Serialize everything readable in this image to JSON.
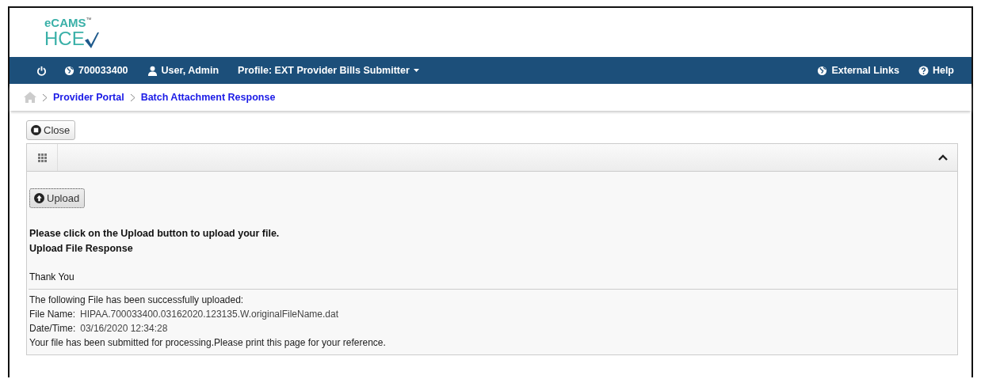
{
  "logo": {
    "brand": "eCAMS",
    "trademark": "™",
    "product": "HCE"
  },
  "navbar": {
    "left": [
      {
        "kind": "power"
      },
      {
        "kind": "globe",
        "label": "700033400"
      },
      {
        "kind": "user",
        "label": "User, Admin"
      },
      {
        "kind": "dropdown",
        "label": "Profile: EXT Provider Bills Submitter"
      }
    ],
    "right": [
      {
        "kind": "globe",
        "label": "External Links"
      },
      {
        "kind": "help",
        "label": "Help"
      }
    ]
  },
  "breadcrumb": [
    "Provider Portal",
    "Batch Attachment Response"
  ],
  "close_button": "Close",
  "panel": {
    "expanded": true,
    "upload_button": "Upload",
    "instruction": "Please click on the Upload button to upload your file.",
    "heading": "Upload File Response",
    "thanks": "Thank You",
    "details": [
      {
        "kind": "text",
        "text": "The following File has been successfully uploaded:"
      },
      {
        "kind": "field",
        "label": "File Name:",
        "value": "HIPAA.700033400.03162020.123135.W.originalFileName.dat"
      },
      {
        "kind": "field",
        "label": "Date/Time:",
        "value": "03/16/2020 12:34:28"
      },
      {
        "kind": "text",
        "text": "Your file has been submitted for processing.Please print this page for your reference."
      }
    ]
  }
}
